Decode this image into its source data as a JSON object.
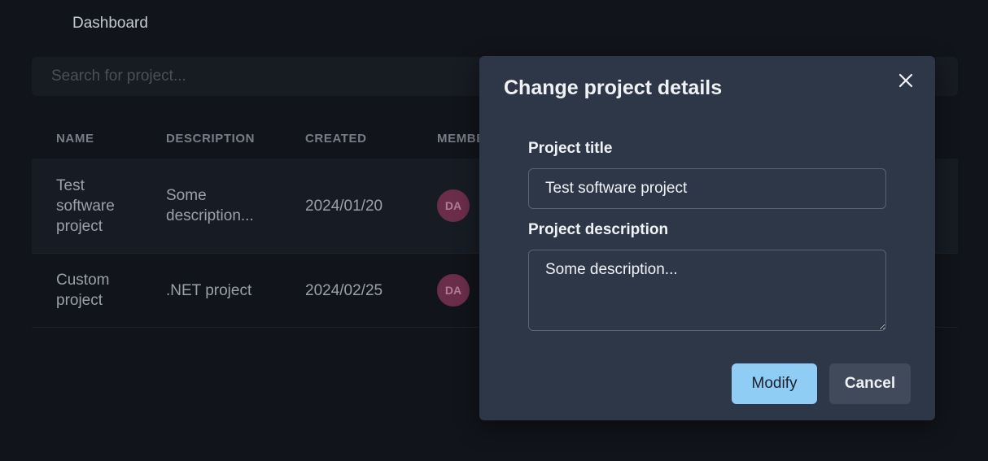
{
  "topbar": {
    "title": "Dashboard"
  },
  "search": {
    "placeholder": "Search for project..."
  },
  "table": {
    "columns": [
      "NAME",
      "DESCRIPTION",
      "CREATED",
      "MEMBERS"
    ],
    "rows": [
      {
        "name": "Test software project",
        "description": "Some description...",
        "created": "2024/01/20",
        "member_initials": "DA"
      },
      {
        "name": "Custom project",
        "description": ".NET project",
        "created": "2024/02/25",
        "member_initials": "DA"
      }
    ]
  },
  "modal": {
    "title": "Change project details",
    "title_label": "Project title",
    "title_value": "Test software project",
    "description_label": "Project description",
    "description_value": "Some description...",
    "modify_label": "Modify",
    "cancel_label": "Cancel",
    "close_icon": "close-icon"
  },
  "colors": {
    "primary_button": "#90cdf4",
    "modal_bg": "#2e3748",
    "avatar_bg": "#6b2e4a"
  }
}
